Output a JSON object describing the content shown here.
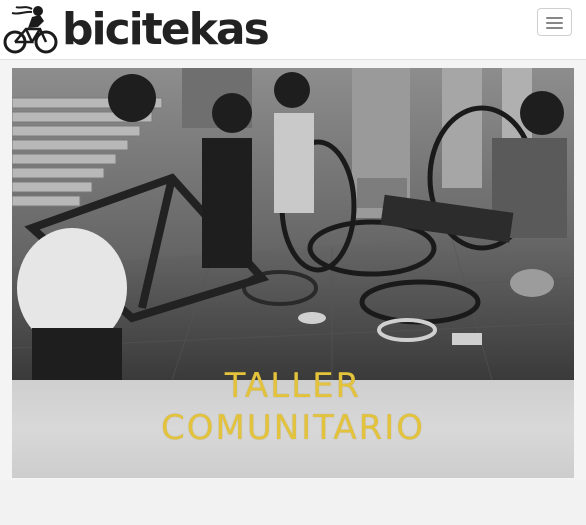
{
  "brand": {
    "name": "bicitekas",
    "logo_icon": "cyclist-logo-icon"
  },
  "nav": {
    "toggle_icon": "hamburger-menu-icon"
  },
  "hero": {
    "image_alt": "",
    "caption_line1": "TALLER",
    "caption_line2": "COMUNITARIO",
    "caption_color": "#e3c23c"
  }
}
